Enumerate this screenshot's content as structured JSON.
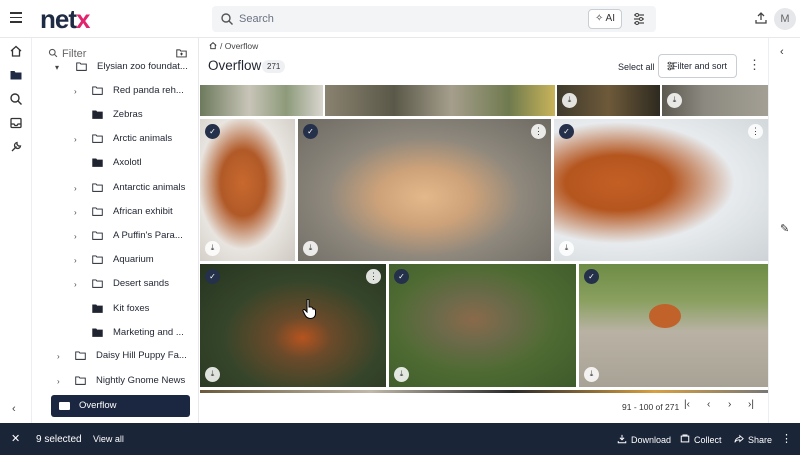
{
  "header": {
    "logo_main": "net",
    "logo_accent": "x",
    "search_placeholder": "Search",
    "ai_label": "AI",
    "avatar_initial": "M"
  },
  "tree": {
    "filter_placeholder": "Filter",
    "items": [
      {
        "label": "Elysian zoo foundat...",
        "expandable": true
      },
      {
        "label": "Red panda reh...",
        "expandable": true
      },
      {
        "label": "Zebras",
        "expandable": false
      },
      {
        "label": "Arctic animals",
        "expandable": true
      },
      {
        "label": "Axolotl",
        "expandable": false
      },
      {
        "label": "Antarctic animals",
        "expandable": true
      },
      {
        "label": "African exhibit",
        "expandable": true
      },
      {
        "label": "A Puffin's Para...",
        "expandable": true
      },
      {
        "label": "Aquarium",
        "expandable": true
      },
      {
        "label": "Desert sands",
        "expandable": true
      },
      {
        "label": "Kit foxes",
        "expandable": false
      },
      {
        "label": "Marketing and ...",
        "expandable": false
      },
      {
        "label": "Daisy Hill Puppy Fa...",
        "expandable": true
      },
      {
        "label": "Nightly Gnome News",
        "expandable": true
      }
    ],
    "selected": "Overflow"
  },
  "main": {
    "breadcrumb": "/ Overflow",
    "title": "Overflow",
    "count": "271",
    "select_all": "Select all",
    "filter_sort": "Filter and sort",
    "pagination": "91 - 100 of 271"
  },
  "bottom_bar": {
    "selected": "9 selected",
    "view_all": "View all",
    "download": "Download",
    "collect": "Collect",
    "share": "Share"
  },
  "colors": {
    "brand_dark": "#1f2a44",
    "brand_accent": "#e0246e",
    "selection": "#1b2740"
  }
}
